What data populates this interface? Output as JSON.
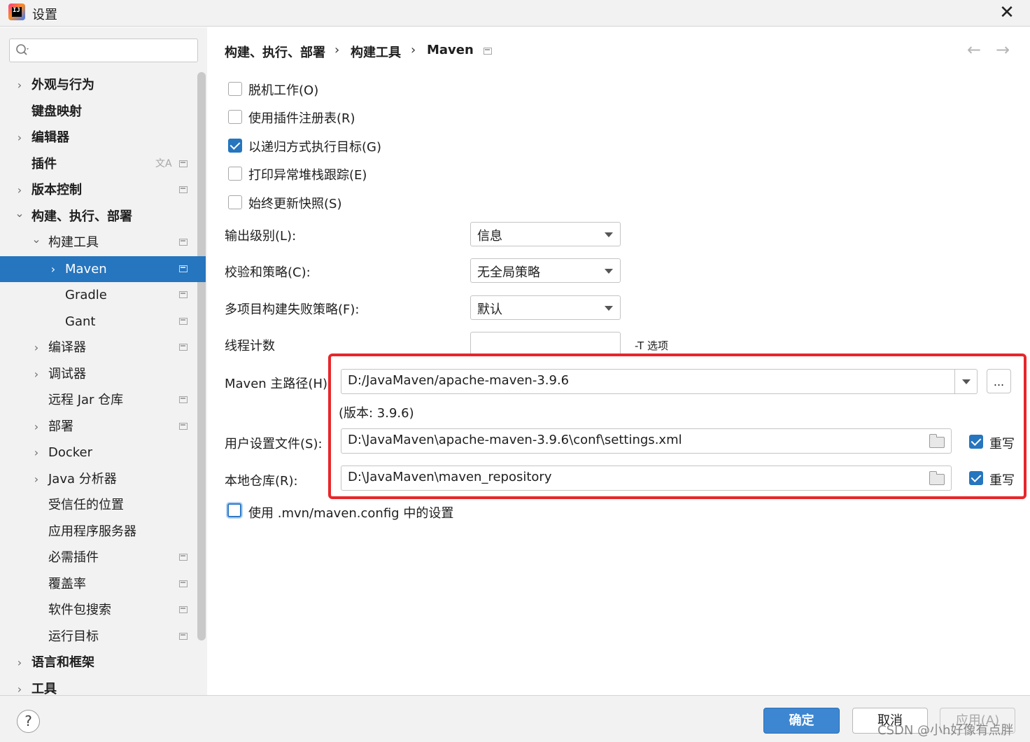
{
  "window": {
    "title": "设置",
    "app_icon": "intellij-idea-icon",
    "app_icon_text": "IJ"
  },
  "search": {
    "placeholder": "",
    "value": ""
  },
  "sidebar": {
    "items": [
      {
        "label": "外观与行为",
        "expandable": true,
        "expanded": false,
        "level": 0,
        "bold": true,
        "project_icon": false
      },
      {
        "label": "键盘映射",
        "expandable": false,
        "level": 0,
        "bold": true,
        "project_icon": false
      },
      {
        "label": "编辑器",
        "expandable": true,
        "expanded": false,
        "level": 0,
        "bold": true,
        "project_icon": false
      },
      {
        "label": "插件",
        "expandable": false,
        "level": 0,
        "bold": true,
        "project_icon": true,
        "translate_icon": true
      },
      {
        "label": "版本控制",
        "expandable": true,
        "expanded": false,
        "level": 0,
        "bold": true,
        "project_icon": true
      },
      {
        "label": "构建、执行、部署",
        "expandable": true,
        "expanded": true,
        "level": 0,
        "bold": true,
        "project_icon": false
      },
      {
        "label": "构建工具",
        "expandable": true,
        "expanded": true,
        "level": 1,
        "bold": false,
        "project_icon": true
      },
      {
        "label": "Maven",
        "expandable": true,
        "expanded": false,
        "level": 2,
        "bold": false,
        "project_icon": true,
        "selected": true
      },
      {
        "label": "Gradle",
        "expandable": false,
        "level": 2,
        "bold": false,
        "project_icon": true
      },
      {
        "label": "Gant",
        "expandable": false,
        "level": 2,
        "bold": false,
        "project_icon": true
      },
      {
        "label": "编译器",
        "expandable": true,
        "expanded": false,
        "level": 1,
        "bold": false,
        "project_icon": true
      },
      {
        "label": "调试器",
        "expandable": true,
        "expanded": false,
        "level": 1,
        "bold": false,
        "project_icon": false
      },
      {
        "label": "远程 Jar 仓库",
        "expandable": false,
        "level": 1,
        "bold": false,
        "project_icon": true
      },
      {
        "label": "部署",
        "expandable": true,
        "expanded": false,
        "level": 1,
        "bold": false,
        "project_icon": true
      },
      {
        "label": "Docker",
        "expandable": true,
        "expanded": false,
        "level": 1,
        "bold": false,
        "project_icon": false
      },
      {
        "label": "Java 分析器",
        "expandable": true,
        "expanded": false,
        "level": 1,
        "bold": false,
        "project_icon": false
      },
      {
        "label": "受信任的位置",
        "expandable": false,
        "level": 1,
        "bold": false,
        "project_icon": false
      },
      {
        "label": "应用程序服务器",
        "expandable": false,
        "level": 1,
        "bold": false,
        "project_icon": false
      },
      {
        "label": "必需插件",
        "expandable": false,
        "level": 1,
        "bold": false,
        "project_icon": true
      },
      {
        "label": "覆盖率",
        "expandable": false,
        "level": 1,
        "bold": false,
        "project_icon": true
      },
      {
        "label": "软件包搜索",
        "expandable": false,
        "level": 1,
        "bold": false,
        "project_icon": true
      },
      {
        "label": "运行目标",
        "expandable": false,
        "level": 1,
        "bold": false,
        "project_icon": true
      },
      {
        "label": "语言和框架",
        "expandable": true,
        "expanded": false,
        "level": 0,
        "bold": true,
        "project_icon": false
      },
      {
        "label": "工具",
        "expandable": true,
        "expanded": false,
        "level": 0,
        "bold": true,
        "project_icon": false
      }
    ]
  },
  "breadcrumb": {
    "items": [
      "构建、执行、部署",
      "构建工具",
      "Maven"
    ],
    "separator": "›"
  },
  "nav": {
    "back": "←",
    "forward": "→"
  },
  "options": {
    "work_offline": {
      "label": "脱机工作(O)",
      "checked": false
    },
    "use_plugin_registry": {
      "label": "使用插件注册表(R)",
      "checked": false
    },
    "execute_recursively": {
      "label": "以递归方式执行目标(G)",
      "checked": true
    },
    "print_stack_traces": {
      "label": "打印异常堆栈跟踪(E)",
      "checked": false
    },
    "always_update_snapshots": {
      "label": "始终更新快照(S)",
      "checked": false
    }
  },
  "form": {
    "output_level": {
      "label": "输出级别(L):",
      "value": "信息"
    },
    "checksum_policy": {
      "label": "校验和策略(C):",
      "value": "无全局策略"
    },
    "multiproject_fail_policy": {
      "label": "多项目构建失败策略(F):",
      "value": "默认"
    },
    "thread_count": {
      "label": "线程计数",
      "value": "",
      "note": "-T 选项"
    },
    "maven_home": {
      "label": "Maven 主路径(H):",
      "value": "D:/JavaMaven/apache-maven-3.9.6",
      "browse": "...",
      "version": "(版本: 3.9.6)"
    },
    "user_settings": {
      "label": "用户设置文件(S):",
      "value": "D:\\JavaMaven\\apache-maven-3.9.6\\conf\\settings.xml",
      "override_label": "重写",
      "override": true
    },
    "local_repo": {
      "label": "本地仓库(R):",
      "value": "D:\\JavaMaven\\maven_repository",
      "override_label": "重写",
      "override": true
    },
    "use_mvn_config": {
      "label": "使用 .mvn/maven.config 中的设置",
      "checked": false
    }
  },
  "footer": {
    "help": "?",
    "ok": "确定",
    "cancel": "取消",
    "apply": "应用(A)"
  },
  "watermark": "CSDN @小h好像有点胖",
  "colors": {
    "selection": "#2675bf",
    "primary_button": "#3d87d2",
    "highlight_box": "#e8262a"
  }
}
